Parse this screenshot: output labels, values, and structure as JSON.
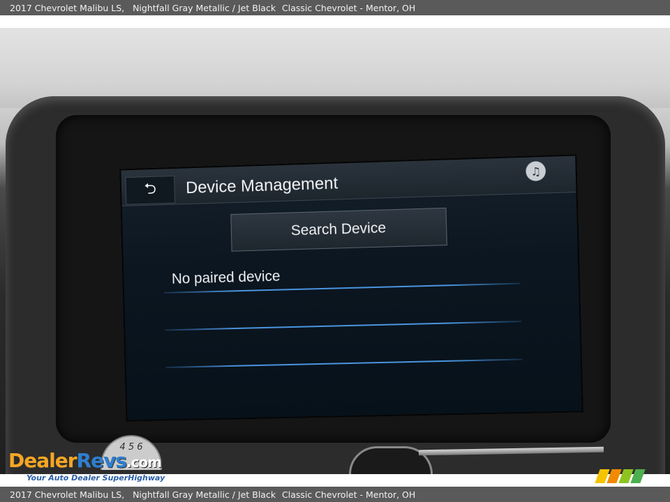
{
  "caption": {
    "vehicle": "2017 Chevrolet Malibu LS,   Nightfall Gray Metallic / Jet Black",
    "dealer": "Classic Chevrolet - Mentor, OH"
  },
  "screen": {
    "back_symbol": "⮌",
    "title": "Device Management",
    "music_icon": "♫",
    "search_button_label": "Search Device",
    "status_text": "No paired device"
  },
  "watermark": {
    "gauge_text": "4 5 6",
    "logo_dealer": "Dealer",
    "logo_revs": "Revs",
    "logo_com": ".com",
    "tagline": "Your Auto Dealer SuperHighway"
  },
  "colors": {
    "list_line": "#4a95e0",
    "stripes": [
      "#f5c400",
      "#f08a00",
      "#8fc31f",
      "#4caf50"
    ]
  }
}
